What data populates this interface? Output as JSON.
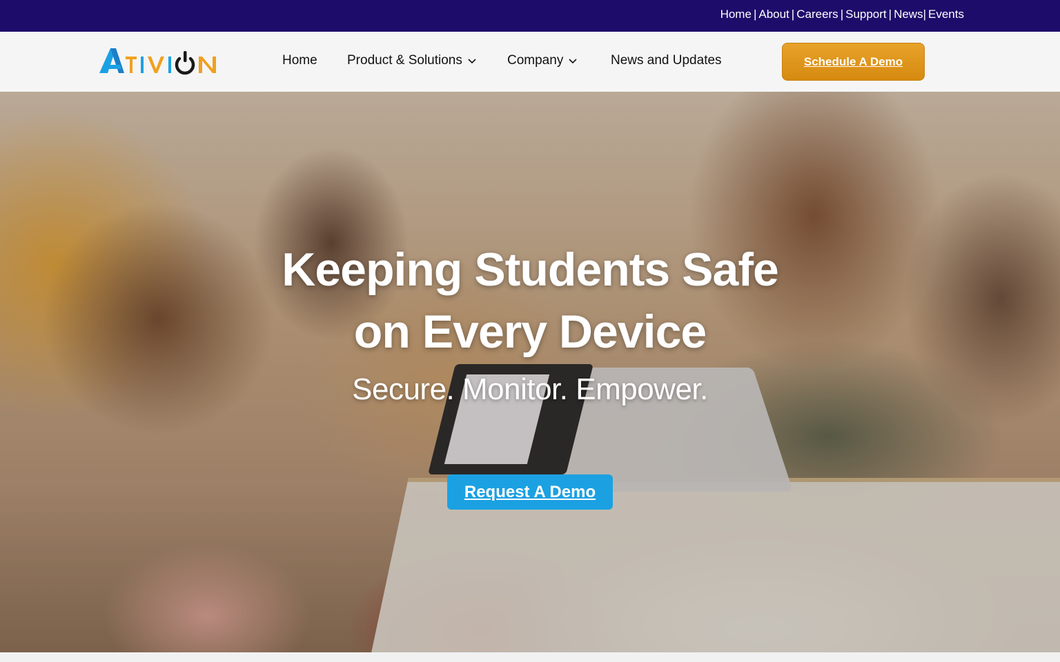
{
  "topbar": {
    "links": [
      {
        "label": "Home"
      },
      {
        "label": "About"
      },
      {
        "label": "Careers"
      },
      {
        "label": "Support"
      },
      {
        "label": "News"
      },
      {
        "label": "Events"
      }
    ],
    "background": "#1e0c6b"
  },
  "brand": {
    "name": "ATIVION",
    "logo_colors": {
      "primary": "#1ba1e2",
      "accent": "#f0a020",
      "dark": "#1a1a1a"
    }
  },
  "nav": {
    "home": "Home",
    "products": "Product & Solutions",
    "company": "Company",
    "news": "News and Updates",
    "cta": "Schedule A Demo",
    "cta_color": "#e39a1e"
  },
  "hero": {
    "title_line1": "Keeping Students Safe",
    "title_line2": "on Every Device",
    "subtitle": "Secure. Monitor. Empower.",
    "cta": "Request A Demo",
    "cta_color": "#1ba1e2"
  }
}
